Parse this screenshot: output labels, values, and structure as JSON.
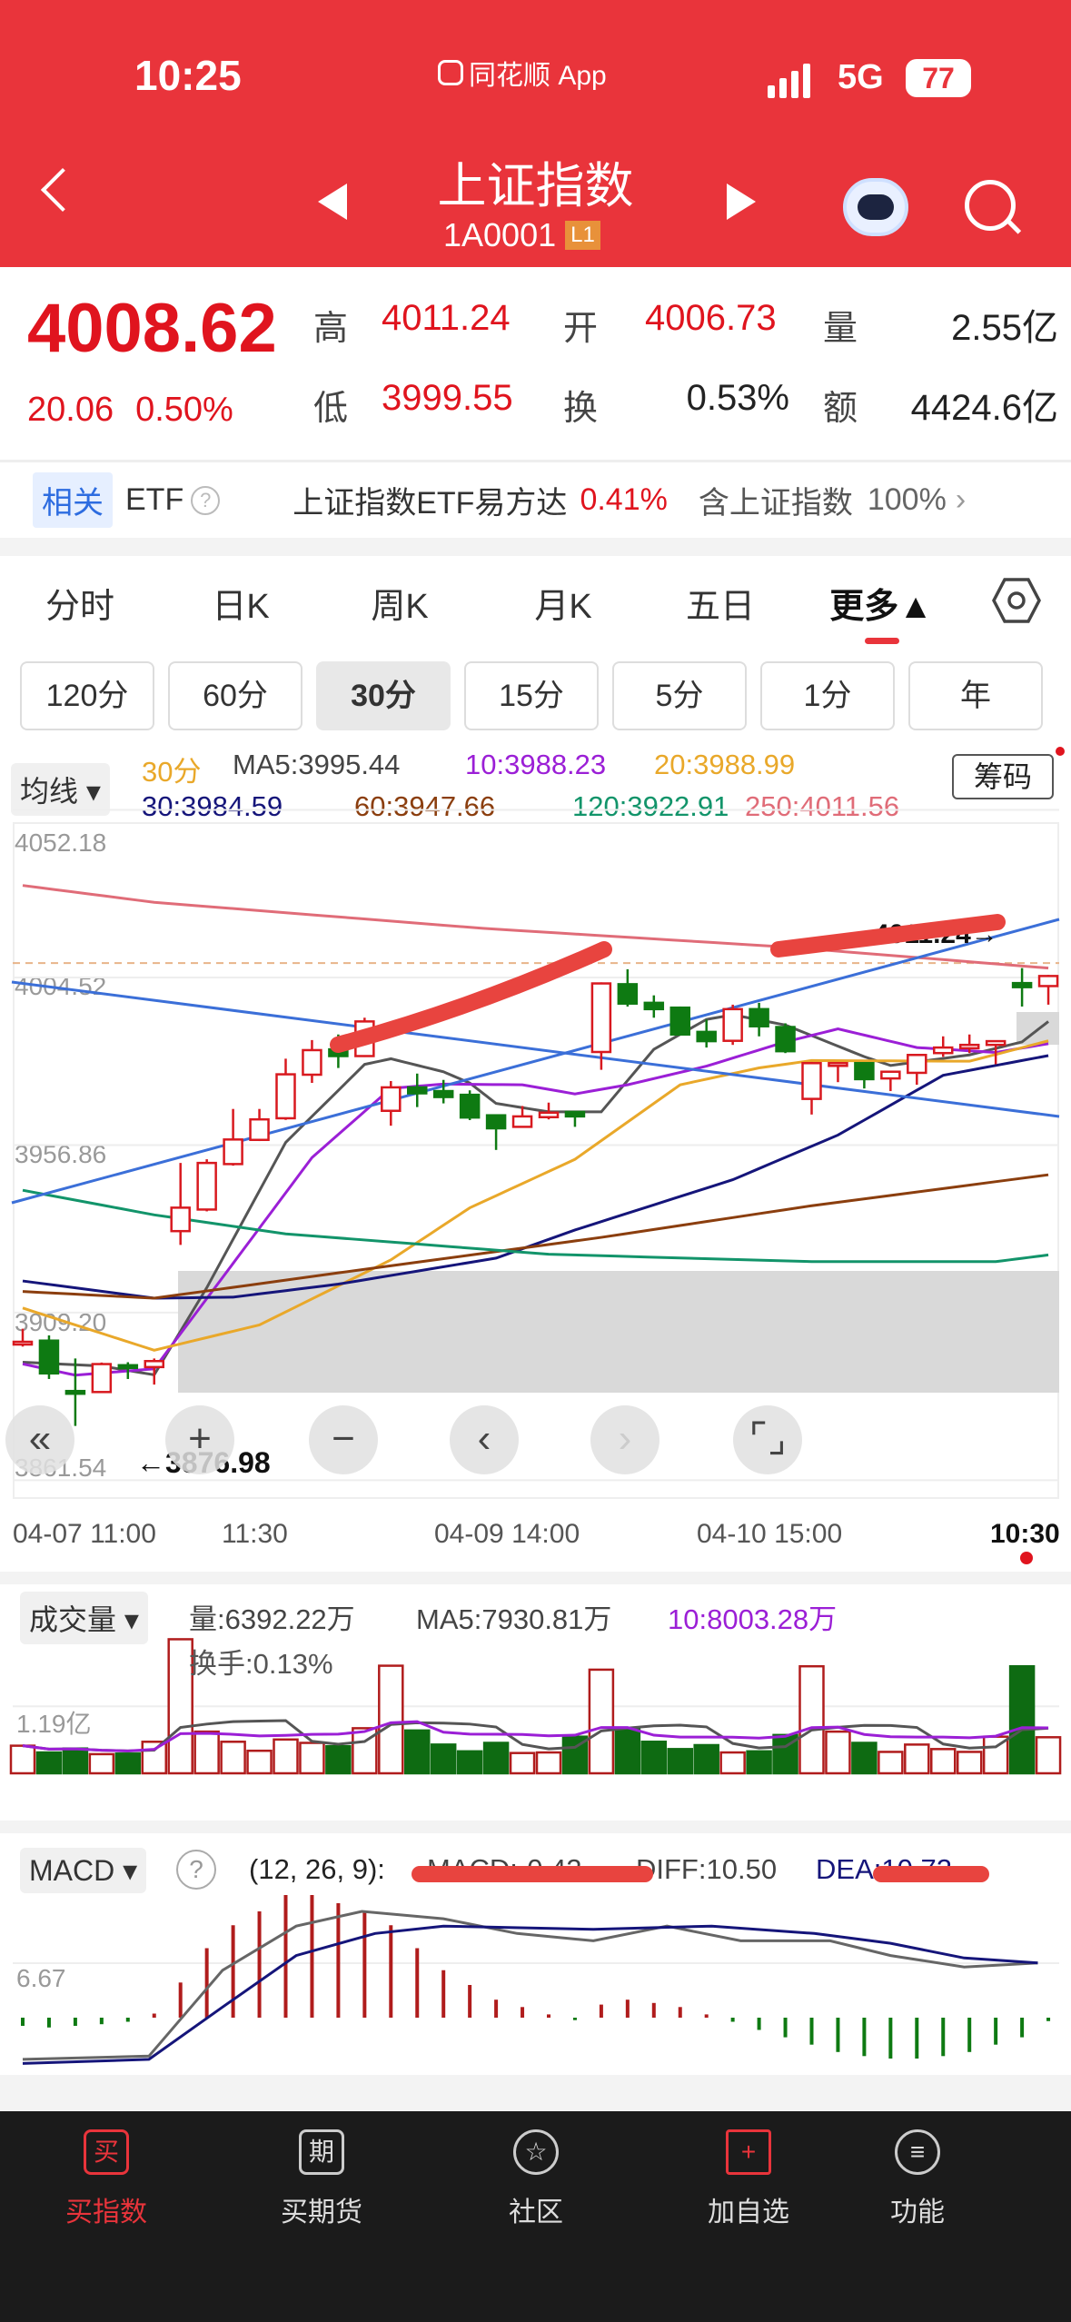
{
  "status": {
    "time": "10:25",
    "app": "同花顺 App",
    "network": "5G",
    "battery": "77"
  },
  "header": {
    "title": "上证指数",
    "code": "1A0001",
    "level": "L1"
  },
  "quote": {
    "price": "4008.62",
    "change": "20.06",
    "pct": "0.50%",
    "fields": [
      {
        "label": "高",
        "value": "4011.24"
      },
      {
        "label": "开",
        "value": "4006.73"
      },
      {
        "label": "量",
        "value": "2.55亿"
      },
      {
        "label": "低",
        "value": "3999.55"
      },
      {
        "label": "换",
        "value": "0.53%"
      },
      {
        "label": "额",
        "value": "4424.6亿"
      }
    ]
  },
  "etf": {
    "tag": "相关",
    "label": "ETF",
    "help": "?",
    "name": "上证指数ETF易方达",
    "pct": "0.41%",
    "hold_label": "含上证指数",
    "hold": "100%",
    "more": "›"
  },
  "tabs": [
    "分时",
    "日K",
    "周K",
    "月K",
    "五日",
    "更多▲"
  ],
  "periods": [
    "120分",
    "60分",
    "30分",
    "15分",
    "5分",
    "1分",
    "年"
  ],
  "legend": {
    "selector": "均线 ▾",
    "period": "30分",
    "chips": "筹码",
    "items": [
      {
        "label": "MA5:3995.44",
        "color": "#444444"
      },
      {
        "label": "10:3988.23",
        "color": "#9B1FD6"
      },
      {
        "label": "20:3988.99",
        "color": "#E9A82A"
      },
      {
        "label": "30:3984.59",
        "color": "#15157A"
      },
      {
        "label": "60:3947.66",
        "color": "#8B3E0E"
      },
      {
        "label": "120:3922.91",
        "color": "#12946A"
      },
      {
        "label": "250:4011.56",
        "color": "#E06C78"
      }
    ]
  },
  "chart_data": {
    "type": "candlestick",
    "period": "30分",
    "y_ticks": [
      "4052.18",
      "4004.52",
      "3956.86",
      "3909.20",
      "3861.54"
    ],
    "x_labels": [
      "04-07 11:00",
      "11:30",
      "04-09 14:00",
      "04-10 15:00",
      "10:30"
    ],
    "high_marker": "4011.24",
    "low_marker": "3876.98",
    "current": 4008.62,
    "colors": {
      "up": "#D8191F",
      "down": "#0E7A12"
    },
    "candles": [
      [
        3900.6,
        3904.62,
        3899.54,
        3900.9
      ],
      [
        3901.23,
        3902.72,
        3890.32,
        3891.91
      ],
      [
        3886.9,
        3896.15,
        3876.98,
        3886.61
      ],
      [
        3886.61,
        3895.0,
        3886.3,
        3894.56
      ],
      [
        3894.24,
        3895.09,
        3890.32,
        3893.5
      ],
      [
        3893.71,
        3896.15,
        3888.73,
        3895.41
      ],
      [
        3932.38,
        3951.77,
        3928.46,
        3939.05
      ],
      [
        3938.52,
        3952.82,
        3938.0,
        3951.77
      ],
      [
        3951.45,
        3967.13,
        3951.0,
        3958.44
      ],
      [
        3958.33,
        3967.13,
        3958.0,
        3964.16
      ],
      [
        3964.48,
        3981.43,
        3964.0,
        3976.98
      ],
      [
        3976.87,
        3986.72,
        3974.54,
        3983.86
      ],
      [
        3984.08,
        3988.31,
        3978.78,
        3982.17
      ],
      [
        3982.17,
        3993.08,
        3981.9,
        3992.02
      ],
      [
        3966.6,
        3975.07,
        3962.36,
        3973.27
      ],
      [
        3973.27,
        3977.19,
        3967.66,
        3971.57
      ],
      [
        3972.21,
        3975.39,
        3968.71,
        3970.52
      ],
      [
        3971.15,
        3972.42,
        3963.95,
        3964.69
      ],
      [
        3965.32,
        3965.5,
        3955.47,
        3961.62
      ],
      [
        3962.04,
        3967.97,
        3961.8,
        3965.01
      ],
      [
        3964.79,
        3968.93,
        3964.16,
        3966.07
      ],
      [
        3966.28,
        3966.5,
        3962.04,
        3965.01
      ],
      [
        3983.33,
        4003.14,
        3978.25,
        4002.83
      ],
      [
        4002.61,
        4006.85,
        3996.26,
        3997.1
      ],
      [
        3997.32,
        3999.44,
        3993.08,
        3995.52
      ],
      [
        3995.94,
        3996.26,
        3988.0,
        3988.31
      ],
      [
        3989.05,
        3992.55,
        3984.6,
        3986.41
      ],
      [
        3986.51,
        3996.79,
        3985.35,
        3995.52
      ],
      [
        3995.52,
        3997.32,
        3987.78,
        3990.64
      ],
      [
        3990.43,
        3991.49,
        3983.02,
        3983.55
      ],
      [
        3969.99,
        3980.5,
        3965.54,
        3980.16
      ],
      [
        3979.52,
        3980.4,
        3974.75,
        3980.16
      ],
      [
        3980.16,
        3980.3,
        3972.95,
        3975.6
      ],
      [
        3975.81,
        3978.0,
        3972.21,
        3977.72
      ],
      [
        3977.4,
        3982.7,
        3974.01,
        3982.49
      ],
      [
        3983.02,
        3987.78,
        3981.96,
        3984.6
      ],
      [
        3984.39,
        3988.31,
        3983.02,
        3985.35
      ],
      [
        3985.35,
        3986.6,
        3979.84,
        3986.41
      ],
      [
        4002.93,
        4007.2,
        3996.26,
        4001.77
      ],
      [
        4002.08,
        4005.26,
        3996.79,
        4004.94
      ]
    ],
    "ma": [
      {
        "name": "MA5",
        "color": "#555555",
        "points": [
          [
            0,
            3895.1
          ],
          [
            3,
            3894.0
          ],
          [
            5,
            3891.5
          ],
          [
            7,
            3916.3
          ],
          [
            10,
            3957.6
          ],
          [
            13,
            3979.8
          ],
          [
            14,
            3981.4
          ],
          [
            16,
            3977.7
          ],
          [
            17,
            3974.5
          ],
          [
            18,
            3968.7
          ],
          [
            20,
            3966.3
          ],
          [
            22,
            3966.3
          ],
          [
            24,
            3984.1
          ],
          [
            26,
            3992.6
          ],
          [
            27,
            3993.9
          ],
          [
            29,
            3991.0
          ],
          [
            32,
            3982.0
          ],
          [
            33,
            3979.5
          ],
          [
            36,
            3982.5
          ],
          [
            38,
            3986.2
          ],
          [
            39,
            3992.0
          ]
        ]
      },
      {
        "name": "MA10",
        "color": "#9B1FD6",
        "points": [
          [
            0,
            3894.6
          ],
          [
            2,
            3891.4
          ],
          [
            5,
            3893.2
          ],
          [
            8,
            3923.2
          ],
          [
            11,
            3953.3
          ],
          [
            14,
            3973.0
          ],
          [
            16,
            3974.2
          ],
          [
            19,
            3974.0
          ],
          [
            21,
            3971.4
          ],
          [
            23,
            3974.0
          ],
          [
            26,
            3979.3
          ],
          [
            29,
            3986.2
          ],
          [
            31,
            3989.9
          ],
          [
            34,
            3984.6
          ],
          [
            37,
            3983.2
          ],
          [
            39,
            3985.7
          ]
        ]
      },
      {
        "name": "MA20",
        "color": "#E9A82A",
        "points": [
          [
            0,
            3910.5
          ],
          [
            5,
            3898.5
          ],
          [
            9,
            3905.7
          ],
          [
            14,
            3924.2
          ],
          [
            17,
            3939.0
          ],
          [
            21,
            3952.8
          ],
          [
            25,
            3974.0
          ],
          [
            28,
            3978.8
          ],
          [
            30,
            3980.9
          ],
          [
            36,
            3980.7
          ],
          [
            39,
            3986.5
          ]
        ]
      },
      {
        "name": "MA30",
        "color": "#15157A",
        "points": [
          [
            0,
            3918.2
          ],
          [
            5,
            3913.3
          ],
          [
            8,
            3913.6
          ],
          [
            12,
            3917.3
          ],
          [
            18,
            3924.7
          ],
          [
            21,
            3932.7
          ],
          [
            27,
            3947.0
          ],
          [
            31,
            3959.7
          ],
          [
            35,
            3976.7
          ],
          [
            39,
            3982.3
          ]
        ]
      },
      {
        "name": "MA60",
        "color": "#8B3E0E",
        "points": [
          [
            0,
            3915.2
          ],
          [
            5,
            3913.3
          ],
          [
            12,
            3920.5
          ],
          [
            22,
            3930.6
          ],
          [
            30,
            3939.6
          ],
          [
            39,
            3948.4
          ]
        ]
      },
      {
        "name": "MA120",
        "color": "#12946A",
        "points": [
          [
            0,
            3944.0
          ],
          [
            5,
            3937.0
          ],
          [
            10,
            3931.6
          ],
          [
            20,
            3925.8
          ],
          [
            30,
            3923.7
          ],
          [
            37,
            3923.7
          ],
          [
            39,
            3925.6
          ]
        ]
      },
      {
        "name": "MA250",
        "color": "#E06C78",
        "points": [
          [
            0,
            4030.7
          ],
          [
            5,
            4025.9
          ],
          [
            17.5,
            4018.5
          ],
          [
            29,
            4013.2
          ],
          [
            39,
            4007.2
          ]
        ]
      }
    ],
    "volume": {
      "unit": "亿",
      "values": [
        0.49,
        0.37,
        0.44,
        0.34,
        0.35,
        0.56,
        2.38,
        0.74,
        0.56,
        0.4,
        0.6,
        0.54,
        0.48,
        0.8,
        1.91,
        0.76,
        0.51,
        0.39,
        0.54,
        0.36,
        0.37,
        0.65,
        1.84,
        0.79,
        0.56,
        0.43,
        0.5,
        0.37,
        0.39,
        0.68,
        1.9,
        0.74,
        0.54,
        0.38,
        0.51,
        0.43,
        0.38,
        0.65,
        1.9,
        0.64
      ],
      "grid_label": "1.19亿",
      "grid_value": 1.19
    },
    "macd": {
      "hist": [
        -1.0,
        -1.2,
        -1.0,
        -0.8,
        -0.5,
        0.5,
        4.3,
        8.5,
        11.3,
        13,
        15,
        15,
        14,
        13,
        11.3,
        8.5,
        5.8,
        4,
        2.2,
        1.3,
        0.4,
        -0.3,
        1.6,
        2.2,
        1.8,
        1.3,
        0.4,
        -0.5,
        -1.5,
        -2.4,
        -3.3,
        -4.2,
        -4.7,
        -5,
        -5,
        -4.7,
        -4.2,
        -3.3,
        -2.4,
        -0.42
      ],
      "diff": [
        [
          0,
          -5.1
        ],
        [
          4.8,
          -4.7
        ],
        [
          7.6,
          5.8
        ],
        [
          10.4,
          11.2
        ],
        [
          12.9,
          13
        ],
        [
          16,
          12.1
        ],
        [
          18.8,
          10.3
        ],
        [
          21.7,
          9.4
        ],
        [
          24.5,
          11.2
        ],
        [
          27.3,
          9.4
        ],
        [
          30.7,
          9.4
        ],
        [
          33,
          7.6
        ],
        [
          35.8,
          6.2
        ],
        [
          38.6,
          6.7
        ]
      ],
      "dea": [
        [
          0,
          -5.6
        ],
        [
          4.8,
          -5.1
        ],
        [
          7.6,
          1.3
        ],
        [
          10.4,
          7.6
        ],
        [
          13.4,
          10.3
        ],
        [
          16,
          11.2
        ],
        [
          21.7,
          10.8
        ],
        [
          26.2,
          11.2
        ],
        [
          30.1,
          10.3
        ],
        [
          33,
          9.1
        ],
        [
          35.8,
          7.3
        ],
        [
          38.6,
          6.7
        ]
      ],
      "grid_label": "6.67",
      "grid_value": 6.67
    }
  },
  "volume_header": {
    "selector": "成交量 ▾",
    "vol": "量:6392.22万",
    "ma5": "MA5:7930.81万",
    "ma10": "10:8003.28万",
    "turnover": "换手:0.13%"
  },
  "macd_header": {
    "selector": "MACD ▾",
    "help": "?",
    "params": "(12, 26, 9):",
    "macd": "MACD:-0.42",
    "diff": "DIFF:10.50",
    "dea": "DEA:10.72"
  },
  "controls": [
    "«",
    "+",
    "−",
    "‹",
    "›",
    "⌜⌟"
  ],
  "nav": [
    {
      "icon": "买",
      "label": "买指数",
      "active": true
    },
    {
      "icon": "期",
      "label": "买期货"
    },
    {
      "icon": "☆",
      "label": "社区"
    },
    {
      "icon": "+",
      "label": "加自选",
      "accent": true
    },
    {
      "icon": "≡",
      "label": "功能"
    }
  ]
}
